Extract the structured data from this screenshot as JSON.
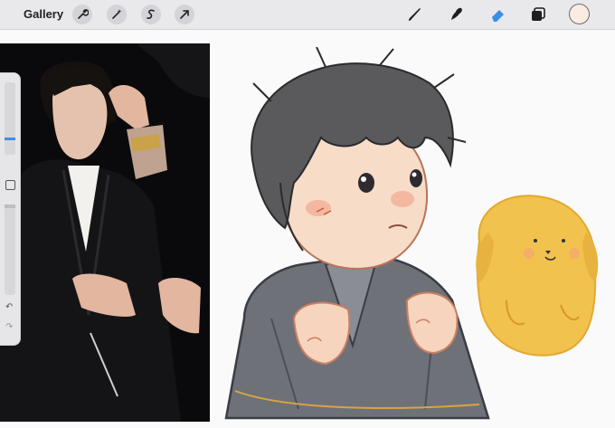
{
  "toolbar": {
    "gallery_label": "Gallery",
    "left_tools": [
      "wrench-icon",
      "magic-wand-icon",
      "selection-icon",
      "arrow-icon"
    ],
    "right_tools": [
      "brush-icon",
      "smudge-icon",
      "eraser-icon",
      "layers-icon"
    ],
    "active_color": "#fbece2",
    "eraser_active_color": "#3a8ee6"
  }
}
